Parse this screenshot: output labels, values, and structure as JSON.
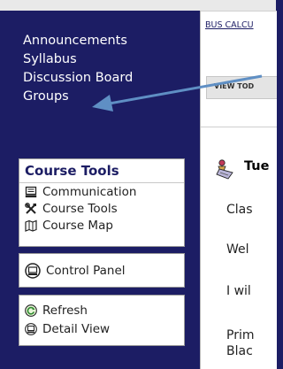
{
  "sidebar": {
    "nav": [
      {
        "label": "Announcements"
      },
      {
        "label": "Syllabus"
      },
      {
        "label": "Discussion Board"
      },
      {
        "label": "Groups"
      }
    ],
    "course_tools": {
      "title": "Course Tools",
      "items": [
        {
          "label": "Communication",
          "icon": "monitor-icon"
        },
        {
          "label": "Course Tools",
          "icon": "tools-icon"
        },
        {
          "label": "Course Map",
          "icon": "map-icon"
        }
      ]
    },
    "control_panel": {
      "label": "Control Panel",
      "icon": "control-panel-icon"
    },
    "utilities": [
      {
        "label": "Refresh",
        "icon": "refresh-icon"
      },
      {
        "label": "Detail View",
        "icon": "detail-view-icon"
      }
    ]
  },
  "content": {
    "breadcrumb": "BUS CALCU",
    "view_toggle": "VIEW TOD",
    "announcement": {
      "heading": "Tue",
      "lines": [
        "Clas",
        "Wel",
        "I wil",
        "Prim",
        "Blac"
      ]
    }
  },
  "colors": {
    "sidebar_bg": "#1c1d64",
    "arrow": "#5f8fc4"
  }
}
